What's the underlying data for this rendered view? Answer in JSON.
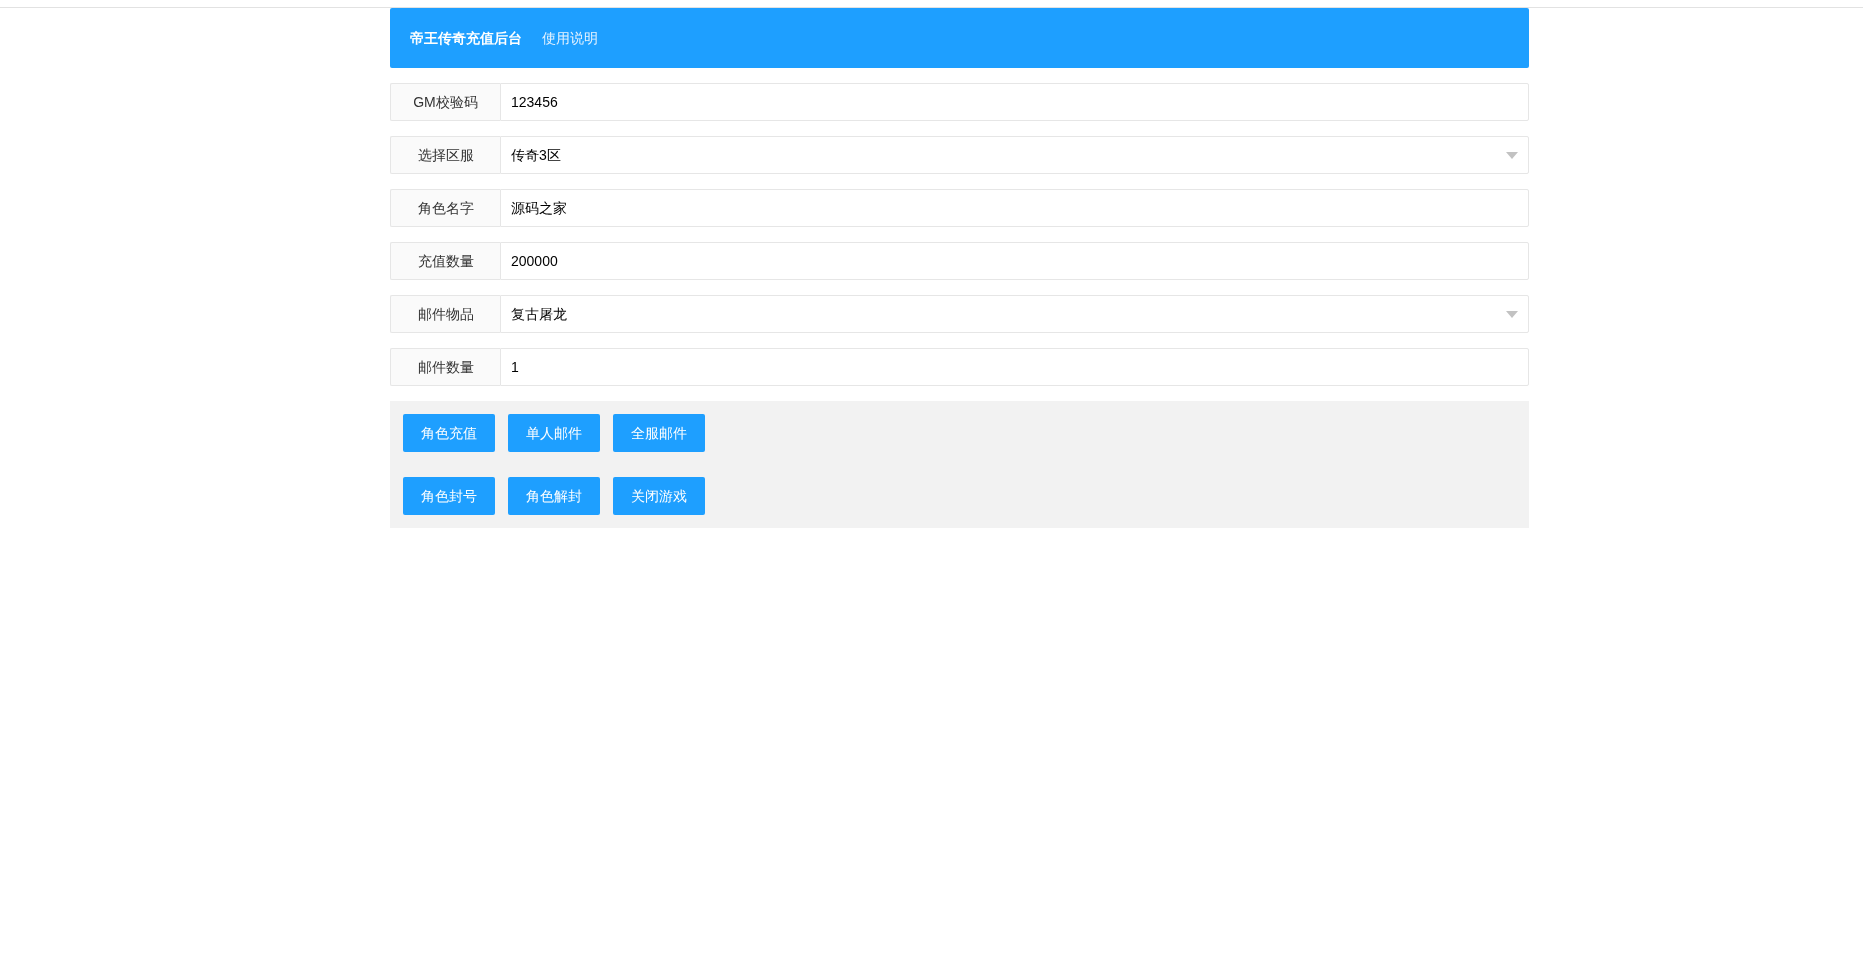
{
  "header": {
    "title": "帝王传奇充值后台",
    "link": "使用说明"
  },
  "fields": [
    {
      "label": "GM校验码",
      "kind": "text",
      "value": "123456"
    },
    {
      "label": "选择区服",
      "kind": "select",
      "value": "传奇3区"
    },
    {
      "label": "角色名字",
      "kind": "text",
      "value": "源码之家"
    },
    {
      "label": "充值数量",
      "kind": "text",
      "value": "200000"
    },
    {
      "label": "邮件物品",
      "kind": "select",
      "value": "复古屠龙"
    },
    {
      "label": "邮件数量",
      "kind": "text",
      "value": "1"
    }
  ],
  "button_rows": [
    [
      "角色充值",
      "单人邮件",
      "全服邮件"
    ],
    [
      "角色封号",
      "角色解封",
      "关闭游戏"
    ]
  ]
}
